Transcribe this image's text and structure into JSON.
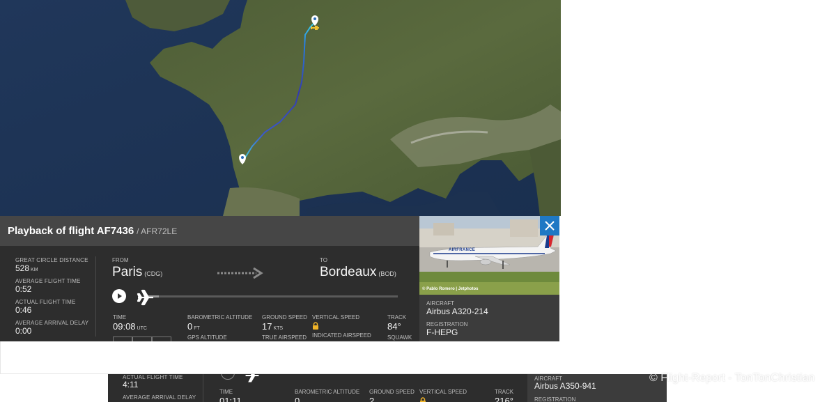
{
  "panel": {
    "title": "Playback of flight AF7436",
    "callsign": "/ AFR72LE",
    "stats": [
      {
        "label": "GREAT CIRCLE DISTANCE",
        "value": "528",
        "unit": "KM"
      },
      {
        "label": "AVERAGE FLIGHT TIME",
        "value": "0:52",
        "unit": ""
      },
      {
        "label": "ACTUAL FLIGHT TIME",
        "value": "0:46",
        "unit": ""
      },
      {
        "label": "AVERAGE ARRIVAL DELAY",
        "value": "0:00",
        "unit": ""
      }
    ],
    "from_label": "FROM",
    "from_city": "Paris",
    "from_code": "(CDG)",
    "to_label": "TO",
    "to_city": "Bordeaux",
    "to_code": "(BOD)",
    "playback_progress": 0.05,
    "metrics": {
      "time_label": "TIME",
      "time_value": "09:08",
      "time_unit": "UTC",
      "baro_label": "BAROMETRIC ALTITUDE",
      "baro_value": "0",
      "baro_unit": "FT",
      "gps_label": "GPS ALTITUDE",
      "gs_label": "GROUND SPEED",
      "gs_value": "17",
      "gs_unit": "KTS",
      "tas_label": "TRUE AIRSPEED",
      "vs_label": "VERTICAL SPEED",
      "vs_icon": "lock-icon",
      "ias_label": "INDICATED AIRSPEED",
      "track_label": "TRACK",
      "track_value": "84°",
      "squawk_label": "SQUAWK"
    }
  },
  "aircraft": {
    "photo_credit": "© Pablo Romero | Jetphotos",
    "livery_text": "AIRFRANCE",
    "aircraft_label": "AIRCRAFT",
    "aircraft_value": "Airbus A320-214",
    "registration_label": "REGISTRATION",
    "registration_value": "F-HEPG"
  },
  "background_panel": {
    "actual_label": "ACTUAL FLIGHT TIME",
    "actual_value": "4:11",
    "delay_label": "AVERAGE ARRIVAL DELAY",
    "time_label": "TIME",
    "time_value": "01:11",
    "baro_label": "BAROMETRIC ALTITUDE",
    "baro_value": "0",
    "gs_label": "GROUND SPEED",
    "gs_value": "2",
    "vs_label": "VERTICAL SPEED",
    "track_label": "TRACK",
    "track_value": "216°",
    "aircraft_label": "AIRCRAFT",
    "aircraft_value": "Airbus A350-941",
    "registration_label": "REGISTRATION"
  },
  "watermark": "© Flight-Report - TonTonChristian",
  "colors": {
    "accent": "#1f78c4",
    "panel": "#2d2d2d",
    "header": "#464646"
  }
}
